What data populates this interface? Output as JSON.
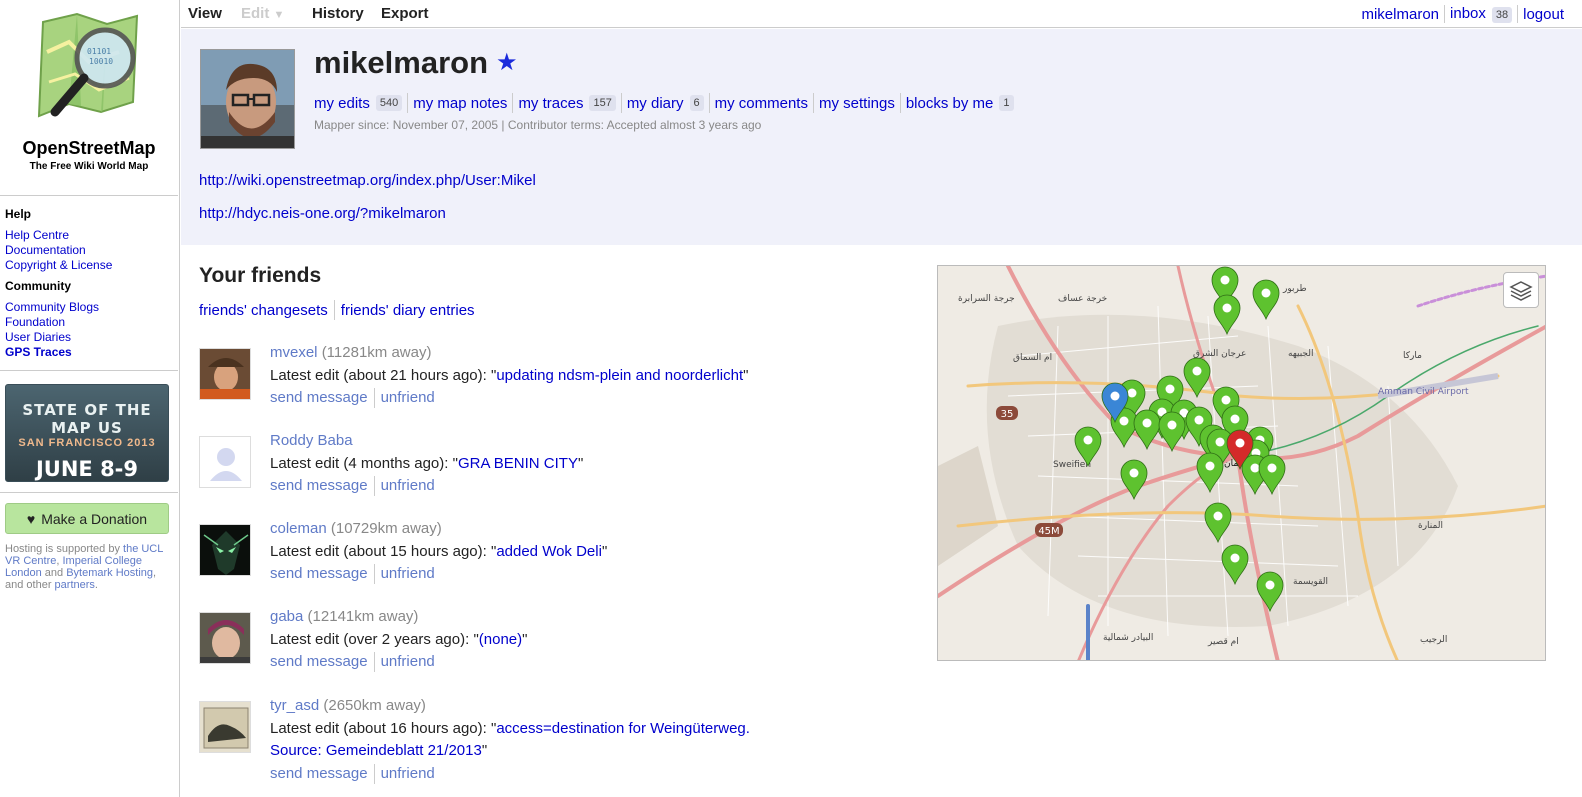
{
  "sidebar": {
    "logo_title": "OpenStreetMap",
    "logo_tagline": "The Free Wiki World Map",
    "help_heading": "Help",
    "help_links": [
      "Help Centre",
      "Documentation",
      "Copyright & License"
    ],
    "community_heading": "Community",
    "community_links": [
      "Community Blogs",
      "Foundation",
      "User Diaries",
      "GPS Traces"
    ],
    "banner": {
      "line1": "STATE OF THE MAP US",
      "line2": "SAN FRANCISCO 2013",
      "line3": "JUNE 8-9"
    },
    "donate_label": "Make a Donation",
    "hosting": {
      "prefix": "Hosting is supported by ",
      "link1": "the UCL VR Centre",
      "sep1": ", ",
      "link2": "Imperial College London",
      "sep2": " and ",
      "link3": "Bytemark Hosting",
      "sep3": ", and other ",
      "link4": "partners",
      "suffix": "."
    }
  },
  "topnav": {
    "tabs": [
      "View",
      "Edit",
      "History",
      "Export"
    ],
    "edit_caret": "▼",
    "user_link": "mikelmaron",
    "inbox_label": "inbox",
    "inbox_count": "38",
    "logout_label": "logout"
  },
  "profile": {
    "username": "mikelmaron",
    "star": "★",
    "links": [
      {
        "label": "my edits",
        "count": "540"
      },
      {
        "label": "my map notes",
        "count": ""
      },
      {
        "label": "my traces",
        "count": "157"
      },
      {
        "label": "my diary",
        "count": "6"
      },
      {
        "label": "my comments",
        "count": ""
      },
      {
        "label": "my settings",
        "count": ""
      },
      {
        "label": "blocks by me",
        "count": "1"
      }
    ],
    "since_text": "Mapper since: November 07, 2005 | Contributor terms: Accepted almost 3 years ago",
    "external_links": [
      "http://wiki.openstreetmap.org/index.php/User:Mikel",
      "http://hdyc.neis-one.org/?mikelmaron"
    ]
  },
  "friends": {
    "title": "Your friends",
    "link_changesets": "friends' changesets",
    "link_diary": "friends' diary entries",
    "send_message_label": "send message",
    "unfriend_label": "unfriend",
    "list": [
      {
        "name": "mvexel",
        "distance": "(11281km away)",
        "edit_prefix": "Latest edit (about 21 hours ago): \"",
        "comment": "updating ndsm-plein and noorderlicht",
        "edit_suffix": "\""
      },
      {
        "name": "Roddy Baba",
        "distance": "",
        "edit_prefix": "Latest edit (4 months ago): \"",
        "comment": "GRA BENIN CITY",
        "edit_suffix": "\""
      },
      {
        "name": "coleman",
        "distance": "(10729km away)",
        "edit_prefix": "Latest edit (about 15 hours ago): \"",
        "comment": "added Wok Deli",
        "edit_suffix": "\""
      },
      {
        "name": "gaba",
        "distance": "(12141km away)",
        "edit_prefix": "Latest edit (over 2 years ago): \"",
        "comment": "(none)",
        "edit_suffix": "\""
      },
      {
        "name": "tyr_asd",
        "distance": "(2650km away)",
        "edit_prefix": "Latest edit (about 16 hours ago): \"",
        "comment": "access=destination for Weingüterweg. Source: Gemeindeblatt 21/2013",
        "edit_suffix": "\""
      }
    ]
  },
  "map": {
    "labels": [
      "Sweifieh",
      "جرجة السرابرة",
      "خرجة عساف",
      "طربور",
      "ام السماق",
      "عرجان الشرق",
      "الجبيهه",
      "ماركا",
      "Amman Civil Airport",
      "المنارة",
      "القويسمة",
      "البيادر شمالية",
      "ام قصير",
      "الرجيب",
      "عمان"
    ],
    "road_shields": [
      "35",
      "45M"
    ],
    "colors": {
      "friend_marker": "#5ec22f",
      "home_marker": "#d42a2a",
      "self_marker": "#3a86d6"
    }
  },
  "colors": {
    "link": "#0000cc",
    "muted_link": "#5f7ac7",
    "header_bg": "#f0f1fa",
    "donate_bg": "#b8e59e"
  }
}
